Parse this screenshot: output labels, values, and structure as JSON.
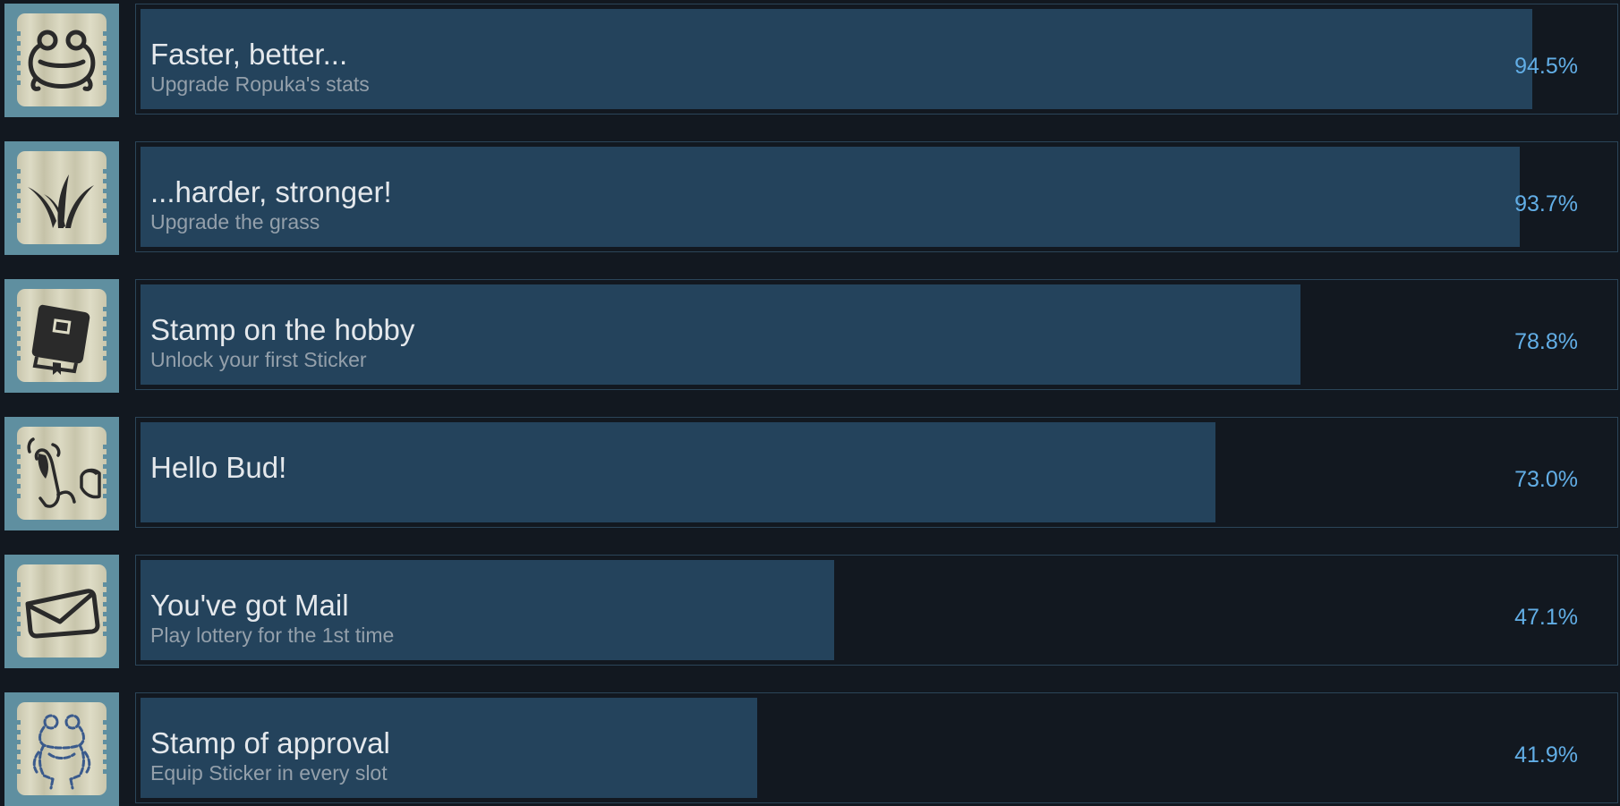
{
  "achievements": [
    {
      "title": "Faster, better...",
      "description": "Upgrade Ropuka's stats",
      "percent_label": "94.5%",
      "percent": 94.5,
      "icon": "frog-head-icon"
    },
    {
      "title": "...harder, stronger!",
      "description": "Upgrade the grass",
      "percent_label": "93.7%",
      "percent": 93.7,
      "icon": "grass-icon"
    },
    {
      "title": "Stamp on the hobby",
      "description": "Unlock your first Sticker",
      "percent_label": "78.8%",
      "percent": 78.8,
      "icon": "book-icon"
    },
    {
      "title": "Hello Bud!",
      "description": "",
      "percent_label": "73.0%",
      "percent": 73.0,
      "icon": "waving-hand-frog-icon"
    },
    {
      "title": "You've got Mail",
      "description": "Play lottery for the 1st time",
      "percent_label": "47.1%",
      "percent": 47.1,
      "icon": "envelope-icon"
    },
    {
      "title": "Stamp of approval",
      "description": "Equip Sticker in every slot",
      "percent_label": "41.9%",
      "percent": 41.9,
      "icon": "frog-figure-icon"
    }
  ],
  "colors": {
    "background": "#121820",
    "progress_fill": "#24435c",
    "border": "#2b4559",
    "percent_text": "#62aee6",
    "title_text": "#e4e8ec",
    "description_text": "#94a0ab"
  }
}
